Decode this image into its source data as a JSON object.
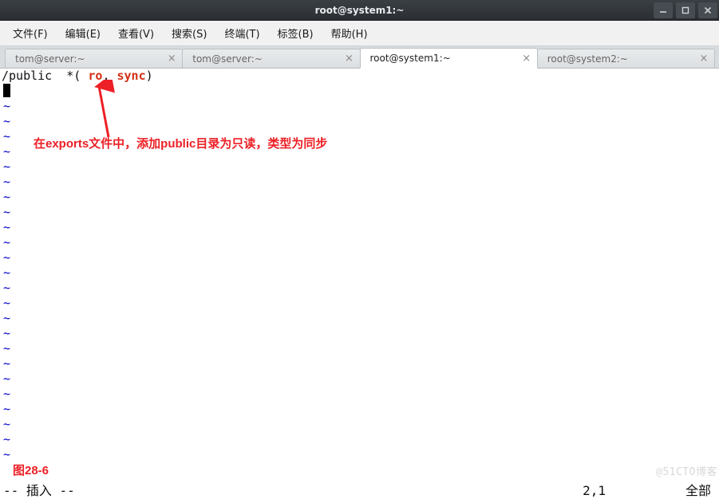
{
  "window": {
    "title": "root@system1:~"
  },
  "menu": {
    "items": [
      {
        "label": "文件(F)"
      },
      {
        "label": "编辑(E)"
      },
      {
        "label": "查看(V)"
      },
      {
        "label": "搜索(S)"
      },
      {
        "label": "终端(T)"
      },
      {
        "label": "标签(B)"
      },
      {
        "label": "帮助(H)"
      }
    ]
  },
  "tabs": {
    "items": [
      {
        "label": "tom@server:~",
        "active": false
      },
      {
        "label": "tom@server:~",
        "active": false
      },
      {
        "label": "root@system1:~",
        "active": true
      },
      {
        "label": "root@system2:~",
        "active": false
      }
    ]
  },
  "editor": {
    "line1_a": "/public  *( ",
    "line1_b": "ro",
    "line1_c": ", ",
    "line1_d": "sync",
    "line1_e": ")",
    "tilde": "~",
    "mode": "-- 插入 --",
    "cursor_pos": "2,1",
    "scroll": "全部"
  },
  "annotation": {
    "text": "在exports文件中，添加public目录为只读，类型为同步",
    "figure": "图28-6"
  },
  "watermark": "@51CTO博客",
  "icons": {
    "close": "×",
    "minimize": "−",
    "maximize": "□",
    "window_close": "×"
  }
}
